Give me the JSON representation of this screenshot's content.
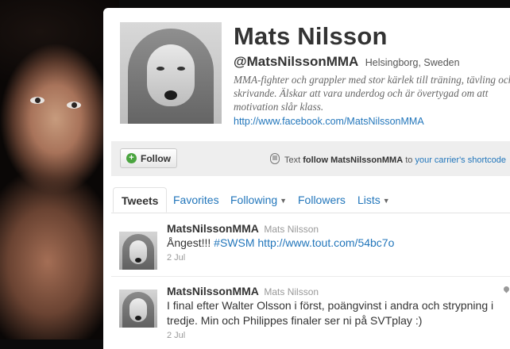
{
  "profile": {
    "name": "Mats Nilsson",
    "handle": "@MatsNilssonMMA",
    "location": "Helsingborg, Sweden",
    "bio": "MMA-fighter och grappler med stor kärlek till träning, tävling och skrivande. Älskar att vara underdog och är övertygad om att motivation slår klass.",
    "url": "http://www.facebook.com/MatsNilssonMMA"
  },
  "actions": {
    "follow_label": "Follow",
    "sms_prefix": "Text",
    "sms_command": "follow MatsNilssonMMA",
    "sms_to": "to",
    "sms_link": "your carrier's shortcode"
  },
  "tabs": [
    {
      "label": "Tweets"
    },
    {
      "label": "Favorites"
    },
    {
      "label": "Following"
    },
    {
      "label": "Followers"
    },
    {
      "label": "Lists"
    }
  ],
  "tweets": [
    {
      "username": "MatsNilssonMMA",
      "display_name": "Mats Nilsson",
      "text_plain": "Ångest!!!",
      "hashtag": "#SWSM",
      "link": "http://www.tout.com/54bc7o",
      "date": "2 Jul"
    },
    {
      "username": "MatsNilssonMMA",
      "display_name": "Mats Nilsson",
      "text": "I final efter Walter Olsson i först, poängvinst i andra och strypning i tredje. Min och Philippes finaler ser ni på SVTplay :)",
      "date": "2 Jul"
    }
  ],
  "colors": {
    "link": "#2276bb",
    "text": "#333333",
    "muted": "#999999",
    "follow_icon": "#4aa43f"
  }
}
